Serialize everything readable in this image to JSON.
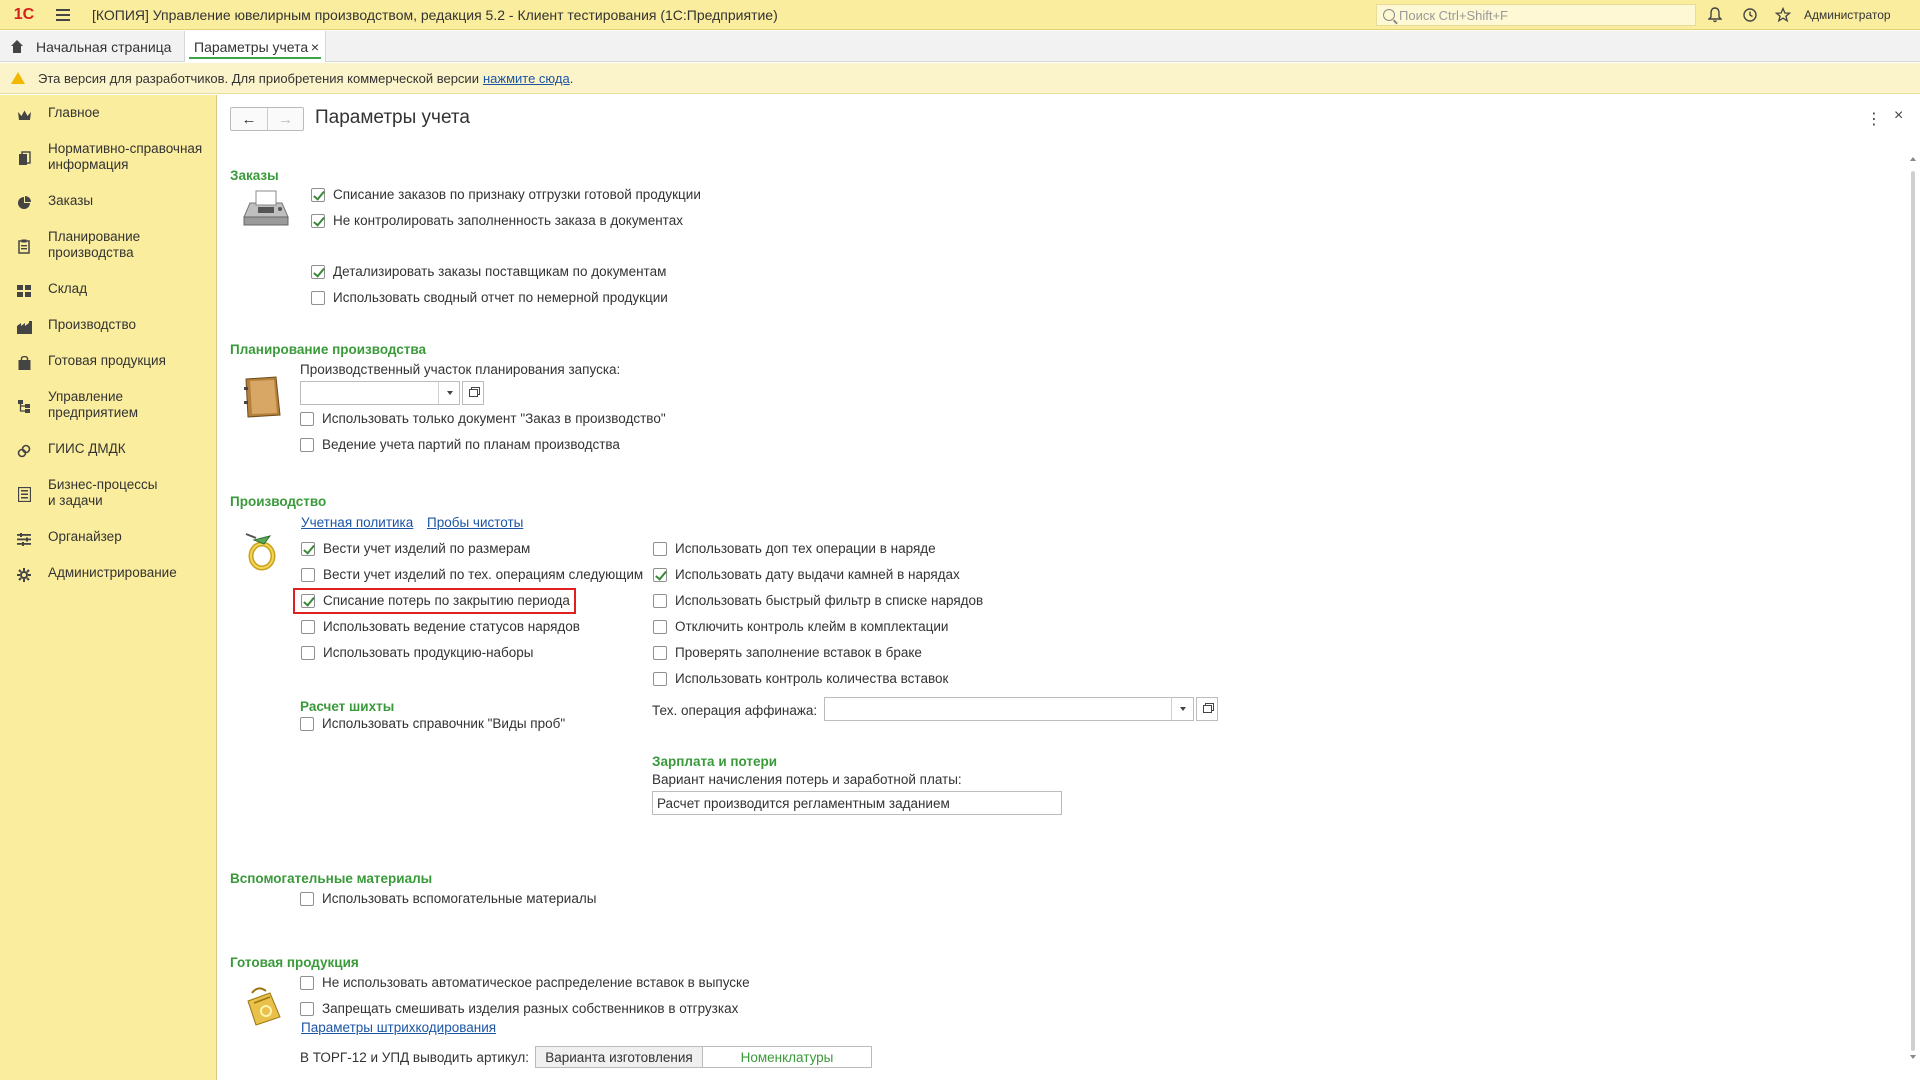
{
  "titlebar": {
    "logo": "1С",
    "title": "[КОПИЯ] Управление ювелирным производством, редакция 5.2  - Клиент тестирования (1С:Предприятие)",
    "search_placeholder": "Поиск Ctrl+Shift+F",
    "user": "Администратор",
    "icons": [
      "bell-icon",
      "history-icon",
      "star-icon"
    ]
  },
  "tabs": {
    "home": "Начальная страница",
    "active": "Параметры учета",
    "close": "×"
  },
  "warning": {
    "text": "Эта версия для разработчиков. Для приобретения коммерческой версии",
    "link": "нажмите сюда",
    "dot": "."
  },
  "sidebar": {
    "items": [
      {
        "label": "Главное",
        "icon": "crown-icon"
      },
      {
        "label": "Нормативно-справочная информация",
        "icon": "books-icon"
      },
      {
        "label": "Заказы",
        "icon": "pie-icon"
      },
      {
        "label": "Планирование производства",
        "icon": "clipboard-icon"
      },
      {
        "label": "Склад",
        "icon": "grid-icon"
      },
      {
        "label": "Производство",
        "icon": "factory-icon"
      },
      {
        "label": "Готовая продукция",
        "icon": "bag-icon"
      },
      {
        "label": "Управление предприятием",
        "icon": "org-icon"
      },
      {
        "label": "ГИИС ДМДК",
        "icon": "link-icon"
      },
      {
        "label": "Бизнес-процессы и задачи",
        "icon": "tasks-icon"
      },
      {
        "label": "Органайзер",
        "icon": "organizer-icon"
      },
      {
        "label": "Администрирование",
        "icon": "gear-icon"
      }
    ]
  },
  "page": {
    "title": "Параметры учета",
    "back": "←",
    "forward": "→",
    "more": "⋮",
    "close": "×"
  },
  "orders": {
    "title": "Заказы",
    "cb1": {
      "label": "Списание заказов по признаку отгрузки готовой продукции",
      "checked": true
    },
    "cb2": {
      "label": "Не контролировать заполненность заказа в документах",
      "checked": true
    },
    "cb3": {
      "label": "Детализировать заказы поставщикам по документам",
      "checked": true
    },
    "cb4": {
      "label": "Использовать сводный отчет по немерной продукции",
      "checked": false
    }
  },
  "planning": {
    "title": "Планирование производства",
    "field_label": "Производственный участок планирования запуска:",
    "field_value": "",
    "cb1": {
      "label": "Использовать только документ \"Заказ в производство\"",
      "checked": false
    },
    "cb2": {
      "label": "Ведение учета партий по планам производства",
      "checked": false
    }
  },
  "production": {
    "title": "Производство",
    "link1": "Учетная политика",
    "link2": "Пробы чистоты",
    "left": [
      {
        "label": "Вести учет изделий по размерам",
        "checked": true
      },
      {
        "label": "Вести учет изделий по тех. операциям следующим",
        "checked": false
      },
      {
        "label": "Списание потерь по закрытию периода",
        "checked": true
      },
      {
        "label": "Использовать ведение статусов нарядов",
        "checked": false
      },
      {
        "label": "Использовать продукцию-наборы",
        "checked": false
      }
    ],
    "right": [
      {
        "label": "Использовать доп тех операции в наряде",
        "checked": false
      },
      {
        "label": "Использовать дату выдачи камней в нарядах",
        "checked": true
      },
      {
        "label": "Использовать быстрый фильтр в списке нарядов",
        "checked": false
      },
      {
        "label": "Отключить контроль клейм в комплектации",
        "checked": false
      },
      {
        "label": "Проверять заполнение вставок в браке",
        "checked": false
      },
      {
        "label": "Использовать контроль количества вставок",
        "checked": false
      }
    ],
    "charge": {
      "title": "Расчет шихты",
      "cb": {
        "label": "Использовать справочник \"Виды проб\"",
        "checked": false
      }
    },
    "refining_label": "Тех. операция аффинажа:",
    "refining_value": "",
    "salary": {
      "title": "Зарплата и потери",
      "label": "Вариант начисления потерь и заработной платы:",
      "value": "Расчет производится регламентным заданием"
    }
  },
  "aux": {
    "title": "Вспомогательные материалы",
    "cb": {
      "label": "Использовать вспомогательные материалы",
      "checked": false
    }
  },
  "finished": {
    "title": "Готовая продукция",
    "cb1": {
      "label": "Не использовать автоматическое распределение вставок в выпуске",
      "checked": false
    },
    "cb2": {
      "label": "Запрещать смешивать изделия разных собственников в отгрузках",
      "checked": false
    },
    "link": "Параметры штрихкодирования",
    "torg_label": "В ТОРГ-12 и УПД выводить артикул:",
    "opt1": "Варианта изготовления",
    "opt2": "Номенклатуры",
    "selected": "Номенклатуры"
  }
}
